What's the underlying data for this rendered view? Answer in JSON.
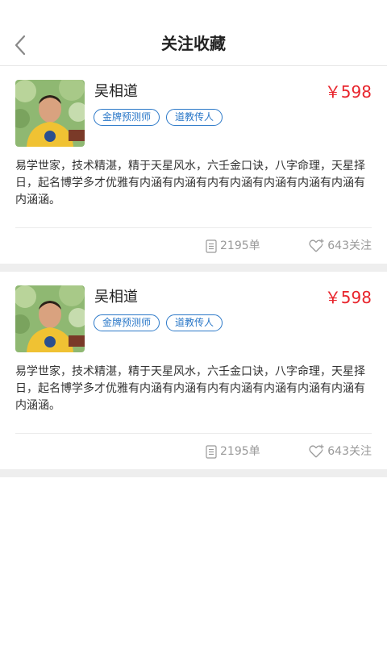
{
  "header": {
    "title": "关注收藏",
    "back_icon": "chevron-left-icon"
  },
  "cards": [
    {
      "name": "吴相道",
      "price": "￥598",
      "tags": [
        "金牌预测师",
        "道教传人"
      ],
      "description": "易学世家，技术精湛，精于天星风水，六壬金口诀，八字命理，天星择日，起名博学多才优雅有内涵有内涵有内有内涵有内涵有内涵有内涵有内涵涵。",
      "orders": "2195单",
      "follows": "643关注"
    },
    {
      "name": "吴相道",
      "price": "￥598",
      "tags": [
        "金牌预测师",
        "道教传人"
      ],
      "description": "易学世家，技术精湛，精于天星风水，六壬金口诀，八字命理，天星择日，起名博学多才优雅有内涵有内涵有内有内涵有内涵有内涵有内涵有内涵涵。",
      "orders": "2195单",
      "follows": "643关注"
    }
  ],
  "colors": {
    "price": "#e8242c",
    "tag": "#2b78c8",
    "muted": "#999999"
  }
}
